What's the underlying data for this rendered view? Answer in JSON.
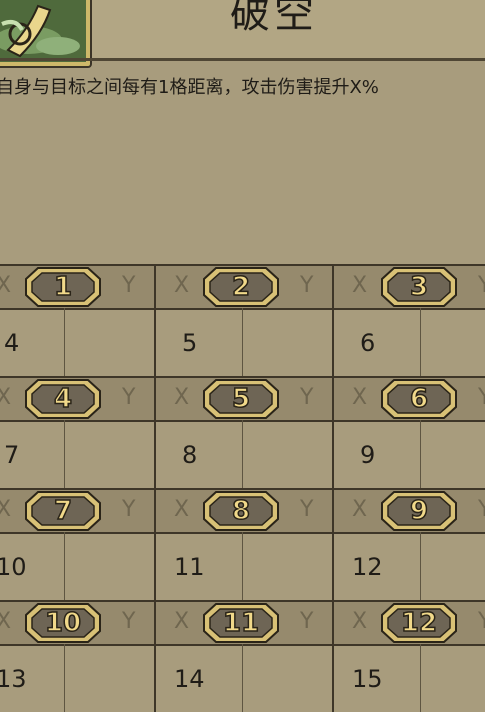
{
  "skill": {
    "icon": "skill-emblem-icon",
    "title": "破空",
    "description": "自身与目标之间每有1格距离，攻击伤害提升X%"
  },
  "table": {
    "x_label": "X",
    "y_label": "Y",
    "rows": [
      {
        "badges": [
          "1",
          "2",
          "3"
        ],
        "values": [
          "4",
          "5",
          "6"
        ]
      },
      {
        "badges": [
          "4",
          "5",
          "6"
        ],
        "values": [
          "7",
          "8",
          "9"
        ]
      },
      {
        "badges": [
          "7",
          "8",
          "9"
        ],
        "values": [
          "10",
          "11",
          "12"
        ]
      },
      {
        "badges": [
          "10",
          "11",
          "12"
        ],
        "values": [
          "13",
          "14",
          "15"
        ]
      }
    ]
  },
  "colors": {
    "background": "#a89c7d",
    "band": "#968a6d",
    "badge_fill": "#6e6555",
    "badge_border": "#d8c176",
    "badge_text": "#f1d98a"
  }
}
